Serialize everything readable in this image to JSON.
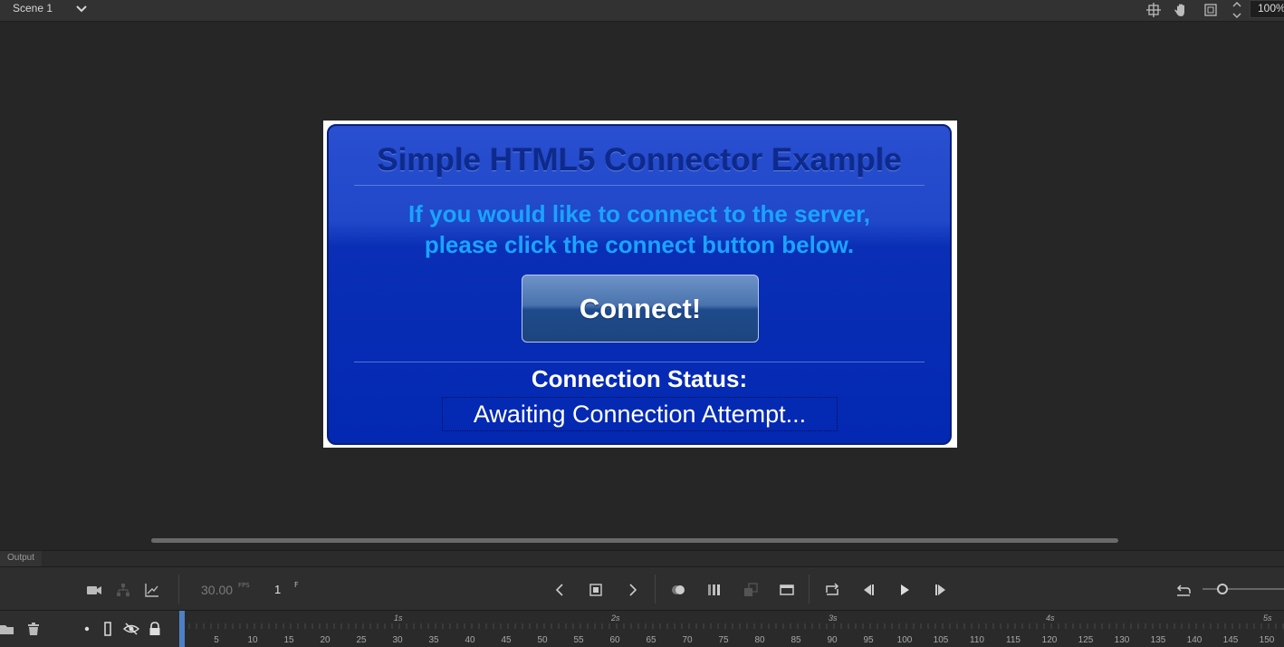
{
  "topbar": {
    "scene_label": "Scene 1",
    "zoom_value": "100%",
    "icons": [
      "center-stage-icon",
      "hand-icon",
      "clip-stage-icon",
      "zoom-stepper-icon"
    ]
  },
  "stage": {
    "title": "Simple HTML5 Connector Example",
    "message_line1": "If you would like to connect to the server,",
    "message_line2": "please click the connect button below.",
    "connect_label": "Connect!",
    "status_label": "Connection Status:",
    "status_value": "Awaiting Connection Attempt...",
    "colors": {
      "panel_blue": "#0328b2",
      "title_blue": "#0d2a8c",
      "message_cyan": "#1aa4ff"
    }
  },
  "output": {
    "tab_label": "Output"
  },
  "timeline": {
    "fps_value": "30.00",
    "fps_unit": "FPS",
    "current_frame": "1",
    "frame_unit": "F",
    "frame_labels": [
      "5",
      "10",
      "15",
      "20",
      "25",
      "30",
      "35",
      "40",
      "45",
      "50",
      "55",
      "60",
      "65",
      "70",
      "75",
      "80",
      "85",
      "90",
      "95",
      "100",
      "105",
      "110",
      "115",
      "120",
      "125",
      "130",
      "135",
      "140",
      "145",
      "150"
    ],
    "second_labels": [
      "1s",
      "2s",
      "3s",
      "4s",
      "5s"
    ],
    "accent": "#4d80c9"
  }
}
